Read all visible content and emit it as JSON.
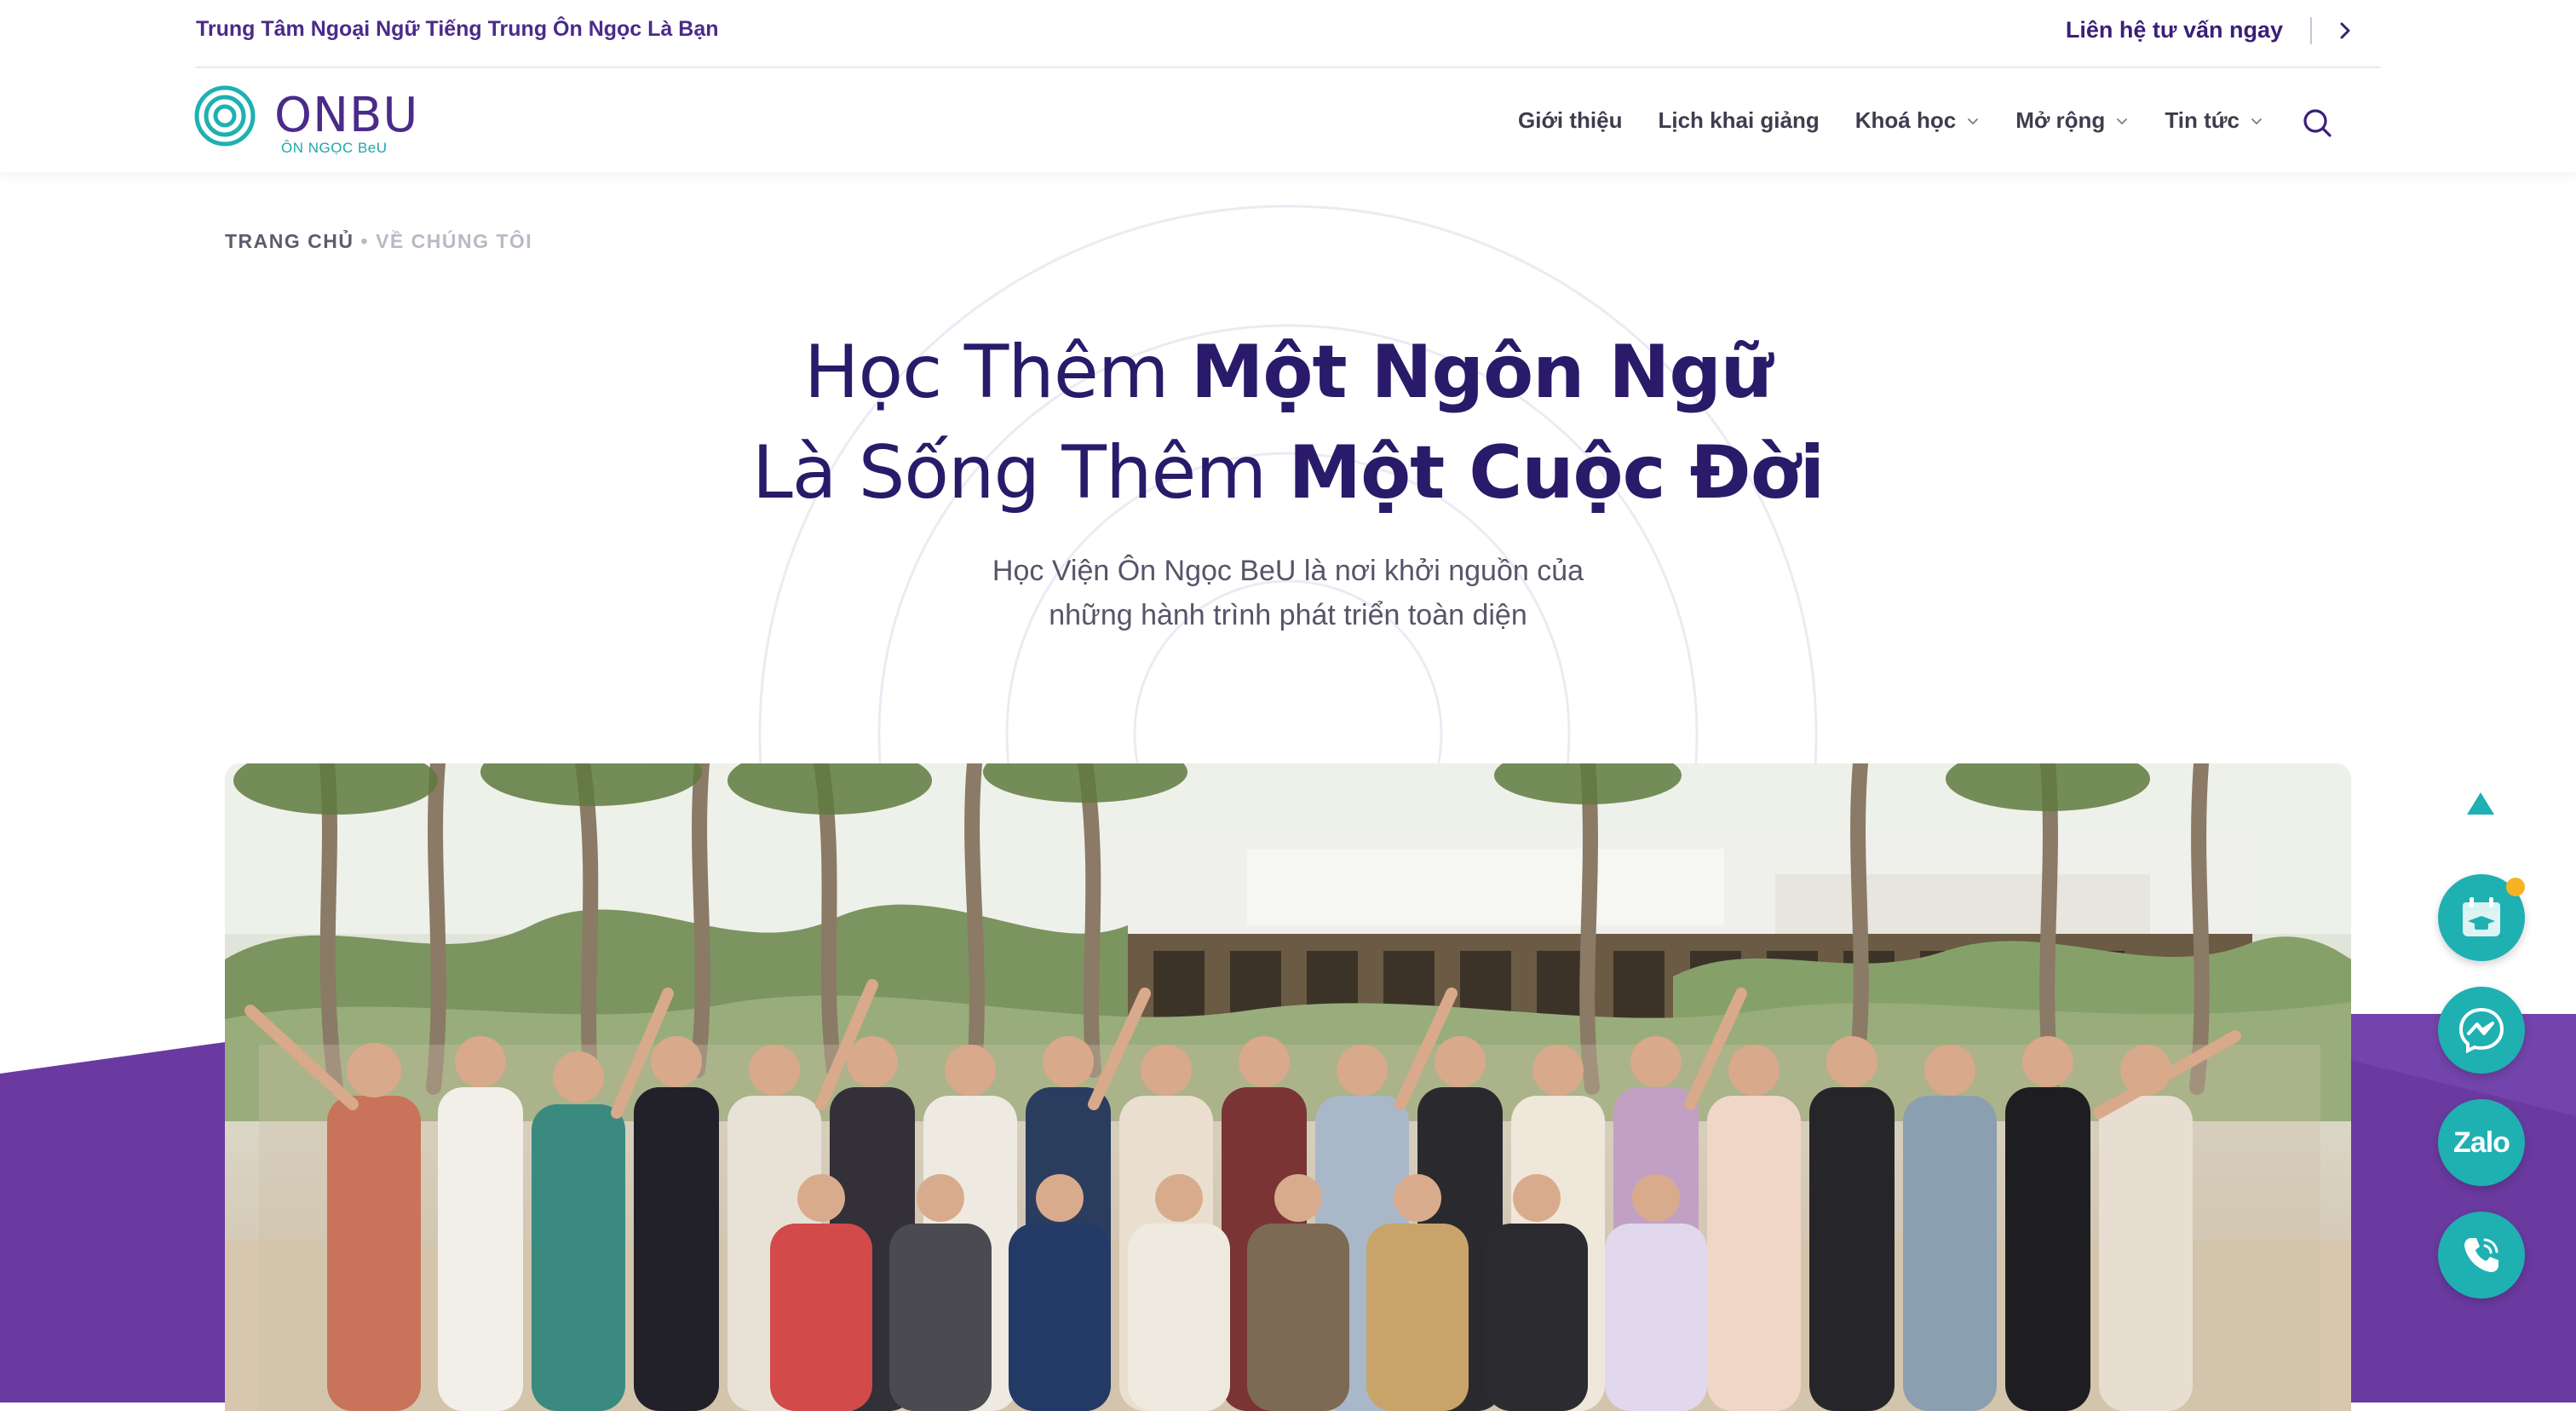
{
  "topbar": {
    "tagline": "Trung Tâm Ngoại Ngữ Tiếng Trung Ôn Ngọc Là Bạn",
    "cta": "Liên hệ tư vấn ngay"
  },
  "logo": {
    "wordmark": "ONBU",
    "subtitle": "ÔN NGỌC BeU"
  },
  "nav": {
    "items": [
      {
        "label": "Giới thiệu",
        "has_dropdown": false
      },
      {
        "label": "Lịch khai giảng",
        "has_dropdown": false
      },
      {
        "label": "Khoá học",
        "has_dropdown": true
      },
      {
        "label": "Mở rộng",
        "has_dropdown": true
      },
      {
        "label": "Tin tức",
        "has_dropdown": true
      }
    ]
  },
  "breadcrumb": {
    "home": "TRANG CHỦ",
    "separator": "•",
    "current": "VỀ CHÚNG TÔI"
  },
  "hero": {
    "line1_light": "Học Thêm ",
    "line1_bold": "Một Ngôn Ngữ",
    "line2_light": "Là Sống Thêm ",
    "line2_bold": "Một Cuộc Đời",
    "subtitle_line1": "Học Viện Ôn Ngọc BeU là nơi khởi nguồn của",
    "subtitle_line2": "những hành trình phát triển toàn diện"
  },
  "widgets": {
    "zalo_label": "Zalo"
  },
  "colors": {
    "brand_purple": "#4b2a8a",
    "heading_purple": "#2a1a6a",
    "band_purple": "#6a3aa0",
    "teal": "#1fb0b2",
    "notification_dot": "#f5b324"
  },
  "icons": {
    "topbar_arrow": "chevron-right-icon",
    "nav_dropdown": "chevron-down-icon",
    "search": "search-icon",
    "scroll_top": "triangle-up-icon",
    "schedule": "calendar-graduation-icon",
    "messenger": "messenger-icon",
    "zalo": "zalo-icon",
    "phone": "phone-icon"
  }
}
